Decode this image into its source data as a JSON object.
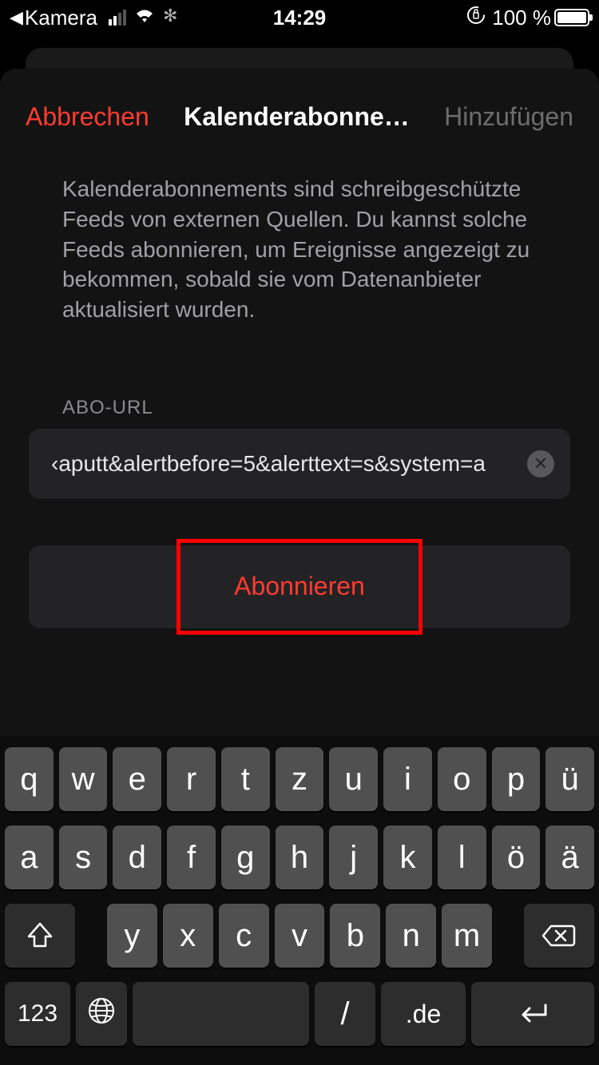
{
  "status": {
    "back_app": "Kamera",
    "time": "14:29",
    "battery_pct": "100 %"
  },
  "nav": {
    "cancel": "Abbrechen",
    "title": "Kalenderabonne…",
    "add": "Hinzufügen"
  },
  "description": "Kalenderabonnements sind schreibgeschützte Feeds von externen Quellen. Du kannst solche Feeds abonnieren, um Ereignisse angezeigt zu bekommen, sobald sie vom Datenanbieter aktualisiert wurden.",
  "url_section": {
    "label": "ABO-URL",
    "value": "‹aputt&alertbefore=5&alerttext=s&system=a"
  },
  "subscribe_label": "Abonnieren",
  "keyboard": {
    "row1": [
      "q",
      "w",
      "e",
      "r",
      "t",
      "z",
      "u",
      "i",
      "o",
      "p",
      "ü"
    ],
    "row2": [
      "a",
      "s",
      "d",
      "f",
      "g",
      "h",
      "j",
      "k",
      "l",
      "ö",
      "ä"
    ],
    "row3": [
      "y",
      "x",
      "c",
      "v",
      "b",
      "n",
      "m"
    ],
    "num_label": "123",
    "slash": "/",
    "tld": ".de"
  }
}
